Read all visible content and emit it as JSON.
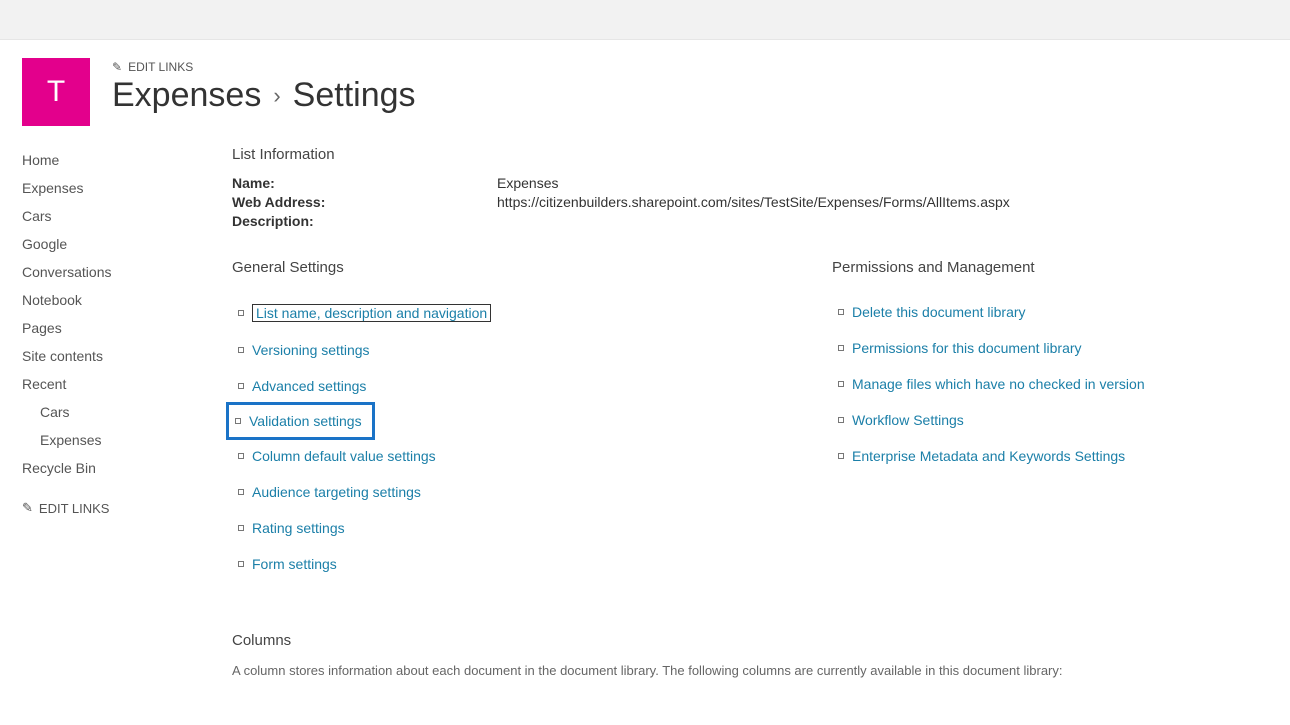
{
  "header": {
    "site_letter": "T",
    "edit_links_label": "EDIT LINKS",
    "breadcrumb_expenses": "Expenses",
    "breadcrumb_settings": "Settings"
  },
  "quick_launch": {
    "home": "Home",
    "expenses": "Expenses",
    "cars": "Cars",
    "google": "Google",
    "conversations": "Conversations",
    "notebook": "Notebook",
    "pages": "Pages",
    "site_contents": "Site contents",
    "recent": "Recent",
    "recent_cars": "Cars",
    "recent_expenses": "Expenses",
    "recycle_bin": "Recycle Bin",
    "edit_links": "EDIT LINKS"
  },
  "list_info": {
    "heading": "List Information",
    "name_label": "Name:",
    "name_value": "Expenses",
    "web_label": "Web Address:",
    "web_value": "https://citizenbuilders.sharepoint.com/sites/TestSite/Expenses/Forms/AllItems.aspx",
    "desc_label": "Description:"
  },
  "general": {
    "heading": "General Settings",
    "items": {
      "list_name": "List name, description and navigation",
      "versioning": "Versioning settings",
      "advanced": "Advanced settings",
      "validation": "Validation settings",
      "column_default": "Column default value settings",
      "audience": "Audience targeting settings",
      "rating": "Rating settings",
      "form": "Form settings"
    }
  },
  "permissions": {
    "heading": "Permissions and Management",
    "items": {
      "delete": "Delete this document library",
      "perms": "Permissions for this document library",
      "manage_files": "Manage files which have no checked in version",
      "workflow": "Workflow Settings",
      "metadata": "Enterprise Metadata and Keywords Settings"
    }
  },
  "columns": {
    "heading": "Columns",
    "description": "A column stores information about each document in the document library. The following columns are currently available in this document library:"
  }
}
